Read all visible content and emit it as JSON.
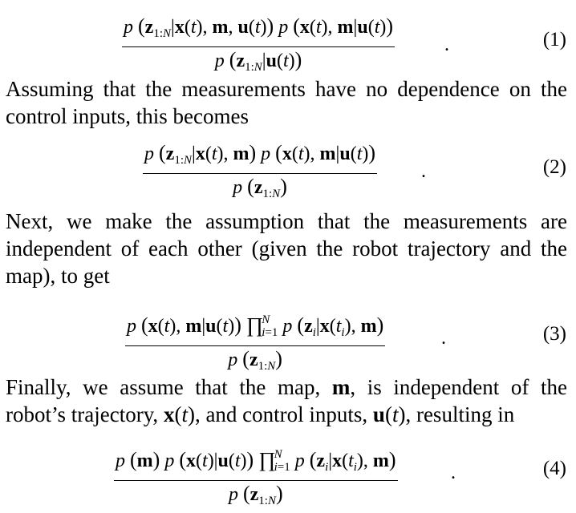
{
  "paragraphs": {
    "p1": "Assuming that the measurements have no dependence on the control inputs, this becomes",
    "p2": "Next, we make the assumption that the measurements are independent of each other (given the robot trajectory and the map), to get",
    "p3": "Finally, we assume that the map, m, is independent of the robot's trajectory, x(t), and control inputs, u(t), resulting in"
  },
  "equations": {
    "eq1": {
      "numerator": "p (z1:N|x(t), m, u(t)) p (x(t), m|u(t))",
      "denominator": "p (z1:N|u(t))",
      "number": "(1)"
    },
    "eq2": {
      "numerator": "p (z1:N|x(t), m) p (x(t), m|u(t))",
      "denominator": "p (z1:N)",
      "number": "(2)"
    },
    "eq3": {
      "numerator": "p (x(t), m|u(t)) ∏i=1N p (zi|x(ti), m)",
      "denominator": "p (z1:N)",
      "number": "(3)"
    },
    "eq4": {
      "numerator": "p (m) p (x(t)|u(t)) ∏i=1N p (zi|x(ti), m)",
      "denominator": "p (z1:N)",
      "number": "(4)"
    }
  }
}
